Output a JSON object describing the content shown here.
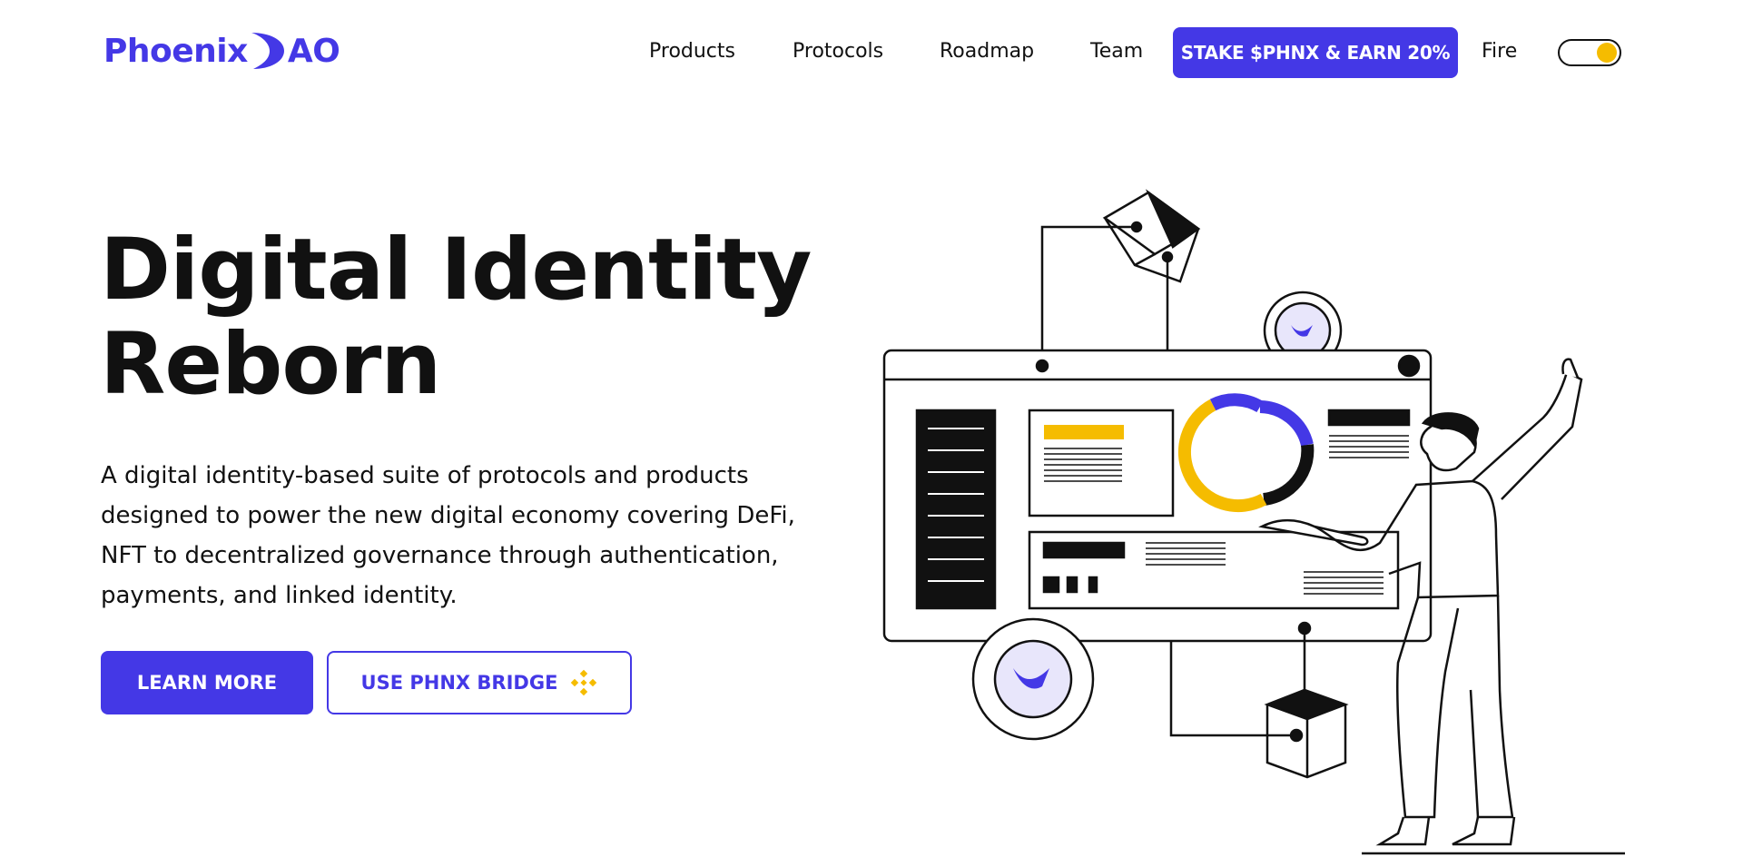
{
  "brand": {
    "name_part1": "Phoenix",
    "name_part2": "AO",
    "color": "#4438e6"
  },
  "nav": {
    "items": [
      {
        "label": "Products"
      },
      {
        "label": "Protocols"
      },
      {
        "label": "Roadmap"
      },
      {
        "label": "Team"
      }
    ],
    "cta_label": "STAKE $PHNX & EARN 20%",
    "theme_label": "Fire",
    "theme_toggle_on": true
  },
  "hero": {
    "title_line1": "Digital Identity",
    "title_line2": "Reborn",
    "description": "A digital identity-based suite of protocols and products designed to power the new digital economy covering DeFi, NFT to decentralized governance through authentication, payments, and linked identity.",
    "primary_button": "LEARN MORE",
    "secondary_button": "USE PHNX BRIDGE",
    "secondary_icon": "binance-icon"
  },
  "colors": {
    "accent": "#4438e6",
    "yellow": "#f5bc00",
    "text": "#111111"
  }
}
